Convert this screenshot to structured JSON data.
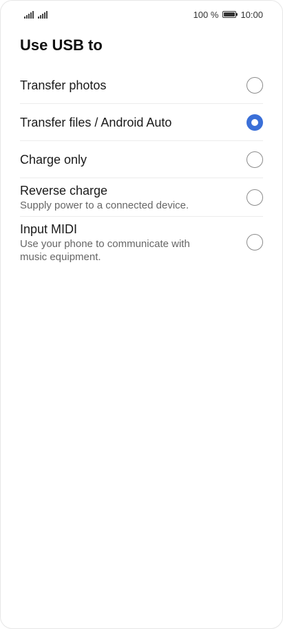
{
  "status_bar": {
    "signal_icon_1": "signal-strength-icon",
    "signal_icon_2": "signal-strength-icon",
    "battery_text": "100 %",
    "battery_level_percent": 100,
    "time": "10:00"
  },
  "page": {
    "title": "Use USB to"
  },
  "options": [
    {
      "label": "Transfer photos",
      "description": "",
      "selected": false
    },
    {
      "label": "Transfer files / Android Auto",
      "description": "",
      "selected": true
    },
    {
      "label": "Charge only",
      "description": "",
      "selected": false
    },
    {
      "label": "Reverse charge",
      "description": "Supply power to a connected device.",
      "selected": false
    },
    {
      "label": "Input MIDI",
      "description": "Use your phone to communicate with music equipment.",
      "selected": false
    }
  ],
  "colors": {
    "accent": "#3a6fd8",
    "text_primary": "#1a1a1a",
    "text_secondary": "#666666",
    "divider": "#ececec"
  }
}
